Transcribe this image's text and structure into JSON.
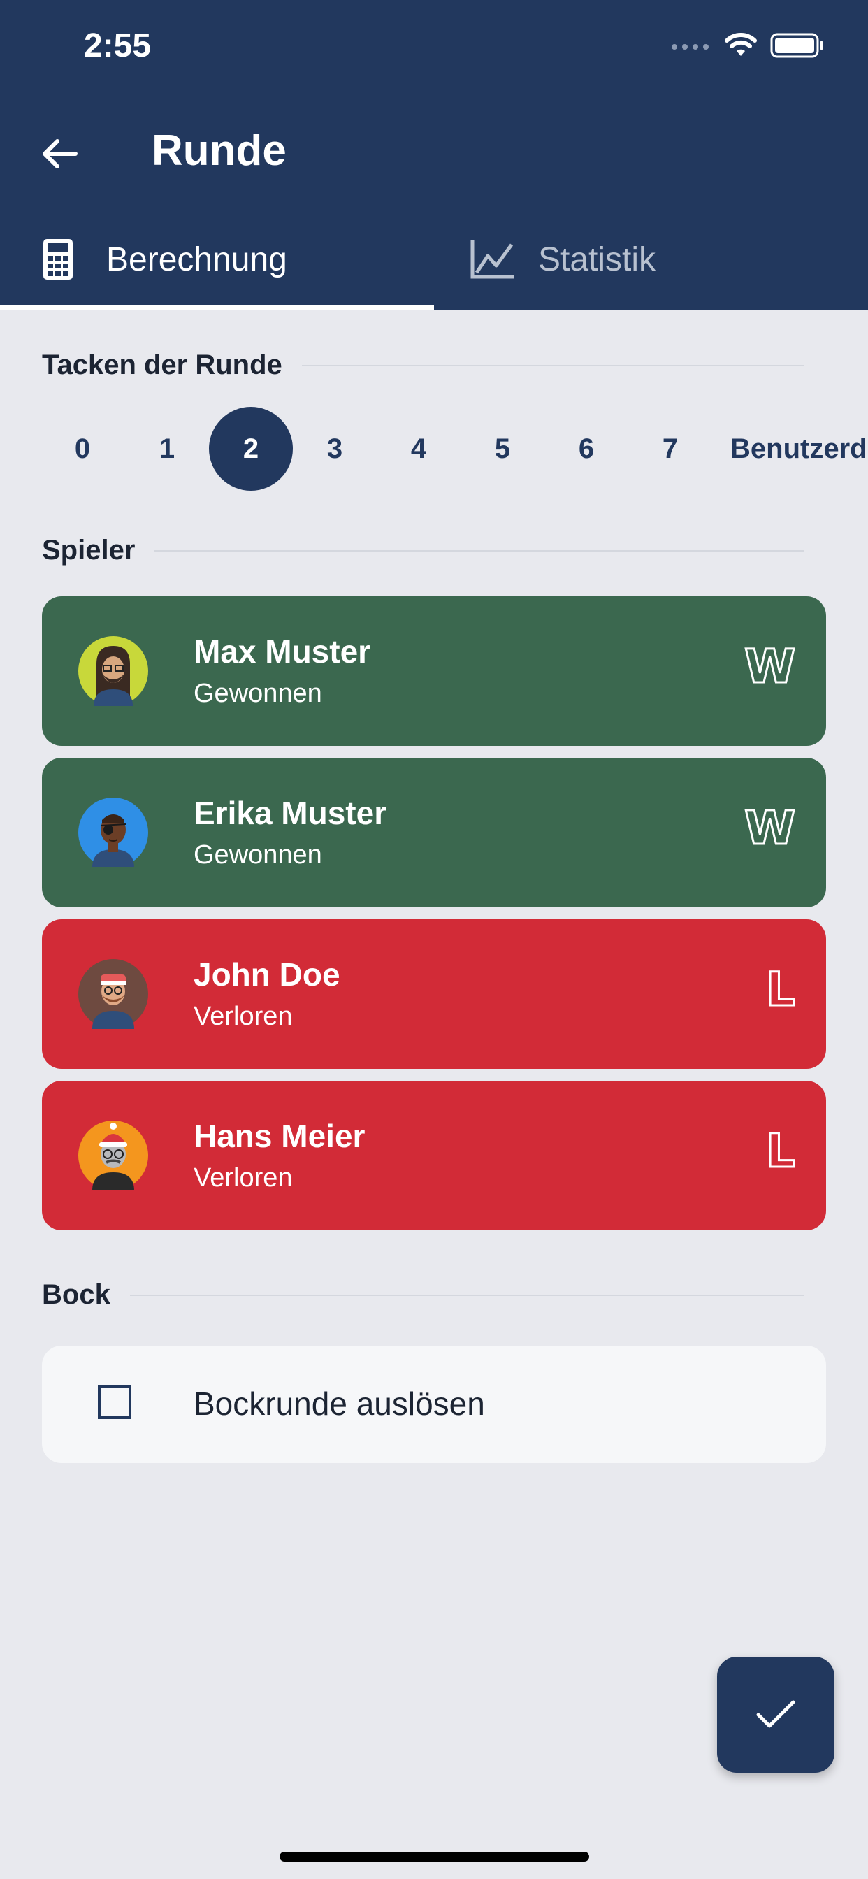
{
  "status_bar": {
    "time": "2:55"
  },
  "header": {
    "title": "Runde"
  },
  "tabs": [
    {
      "label": "Berechnung",
      "icon": "calculator-icon",
      "active": true
    },
    {
      "label": "Statistik",
      "icon": "chart-line-icon",
      "active": false
    }
  ],
  "tacken": {
    "heading": "Tacken der Runde",
    "options": [
      "0",
      "1",
      "2",
      "3",
      "4",
      "5",
      "6",
      "7",
      "Benutzerd"
    ],
    "selected": "2"
  },
  "players": {
    "heading": "Spieler",
    "items": [
      {
        "name": "Max Muster",
        "status": "Gewonnen",
        "badge": "W",
        "result": "won"
      },
      {
        "name": "Erika Muster",
        "status": "Gewonnen",
        "badge": "W",
        "result": "won"
      },
      {
        "name": "John Doe",
        "status": "Verloren",
        "badge": "L",
        "result": "lost"
      },
      {
        "name": "Hans Meier",
        "status": "Verloren",
        "badge": "L",
        "result": "lost"
      }
    ]
  },
  "bock": {
    "heading": "Bock",
    "checkbox_label": "Bockrunde auslösen",
    "checked": false
  },
  "colors": {
    "primary": "#22385e",
    "won": "#3b684f",
    "lost": "#d22b37",
    "background": "#e8e9ee"
  }
}
